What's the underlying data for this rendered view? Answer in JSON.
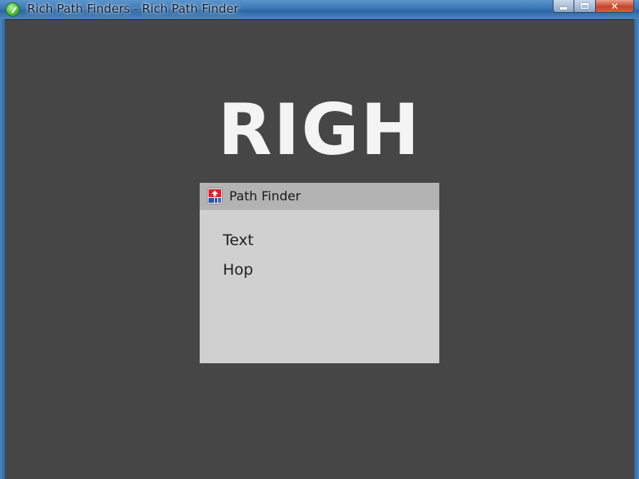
{
  "window": {
    "title": "Rich Path Finders - Rich Path Finder",
    "app_icon": "green-check-icon",
    "caption_buttons": {
      "minimize_icon": "minimize-icon",
      "maximize_icon": "maximize-icon",
      "close_label": "✕"
    },
    "background_color": "#464646"
  },
  "main": {
    "heading": "RIGH"
  },
  "dialog": {
    "title": "Path Finder",
    "icon": "path-finder-app-icon",
    "items": [
      {
        "label": "Text"
      },
      {
        "label": "Hop"
      }
    ],
    "background_color": "#d0d0d0",
    "titlebar_color": "#b3b3b3"
  }
}
